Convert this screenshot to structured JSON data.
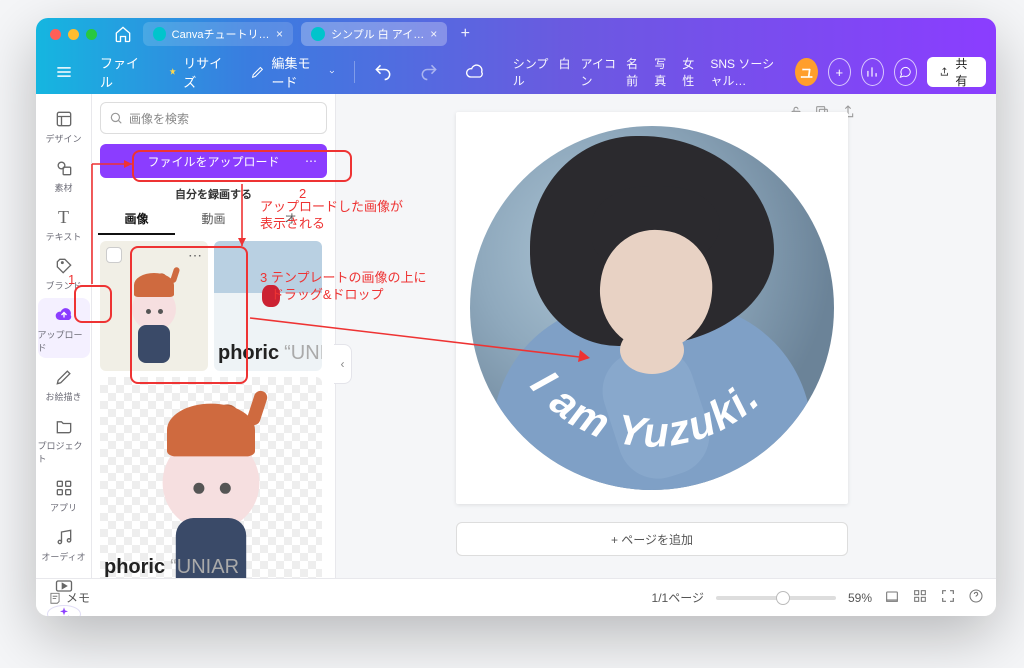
{
  "tabs": [
    {
      "label": "Canvaチュートリア…"
    },
    {
      "label": "シンプル 白 アイ…"
    }
  ],
  "toolbar": {
    "file": "ファイル",
    "resize": "リサイズ",
    "editmode": "編集モード",
    "doc_keywords": [
      "シンプル",
      "白",
      "アイコン",
      "名前",
      "写真",
      "女性",
      "SNS ソーシャル…"
    ],
    "avatar_letter": "ユ",
    "share": "共有"
  },
  "rail": [
    {
      "id": "design",
      "label": "デザイン"
    },
    {
      "id": "elements",
      "label": "素材"
    },
    {
      "id": "text",
      "label": "テキスト"
    },
    {
      "id": "brand",
      "label": "ブランド"
    },
    {
      "id": "uploads",
      "label": "アップロード",
      "active": true
    },
    {
      "id": "draw",
      "label": "お絵描き"
    },
    {
      "id": "projects",
      "label": "プロジェクト"
    },
    {
      "id": "apps",
      "label": "アプリ"
    },
    {
      "id": "audio",
      "label": "オーディオ"
    },
    {
      "id": "video",
      "label": ""
    }
  ],
  "panel": {
    "search_placeholder": "画像を検索",
    "upload_button": "ファイルをアップロード",
    "record_self": "自分を録画する",
    "tabs": [
      {
        "label": "画像",
        "active": true
      },
      {
        "label": "動画"
      },
      {
        "label": "オ"
      }
    ],
    "watermark_a": "phoric",
    "watermark_b": "UNIAR"
  },
  "canvas": {
    "arc_text": "I am Yuzuki.",
    "add_page": "+ ページを追加"
  },
  "footer": {
    "notes": "メモ",
    "page": "1/1ページ",
    "zoom": "59%"
  },
  "annotations": {
    "n1": "1",
    "n2": "2",
    "t2": "アップロードした画像が\n表示される",
    "n3": "3 テンプレートの画像の上に\n   ドラッグ&ドロップ"
  }
}
